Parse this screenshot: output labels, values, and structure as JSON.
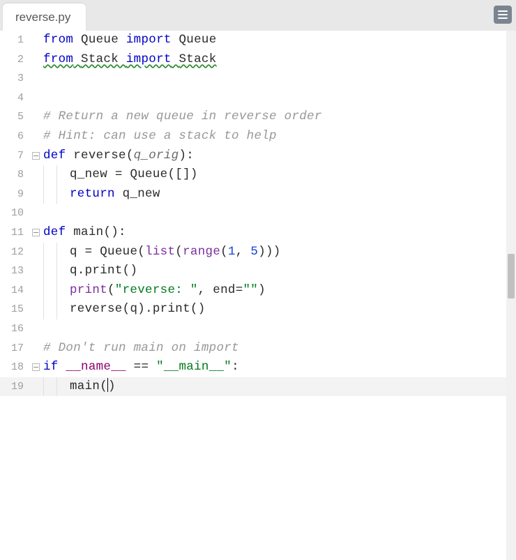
{
  "tab": {
    "title": "reverse.py"
  },
  "icons": {
    "menu": "menu-icon"
  },
  "code": {
    "lines": [
      {
        "n": 1,
        "indent": 0,
        "fold": false,
        "current": false,
        "tokens": [
          [
            "from",
            "kw"
          ],
          [
            " ",
            "p"
          ],
          [
            "Queue",
            "id"
          ],
          [
            " ",
            "p"
          ],
          [
            "import",
            "kw"
          ],
          [
            " ",
            "p"
          ],
          [
            "Queue",
            "id"
          ]
        ]
      },
      {
        "n": 2,
        "indent": 0,
        "fold": false,
        "current": false,
        "tokens": [
          [
            "from",
            "kw warn"
          ],
          [
            " ",
            "p warn"
          ],
          [
            "Stack",
            "id warn"
          ],
          [
            " ",
            "p warn"
          ],
          [
            "import",
            "kw warn"
          ],
          [
            " ",
            "p warn"
          ],
          [
            "Stack",
            "id warn"
          ]
        ]
      },
      {
        "n": 3,
        "indent": 0,
        "fold": false,
        "current": false,
        "tokens": []
      },
      {
        "n": 4,
        "indent": 0,
        "fold": false,
        "current": false,
        "tokens": []
      },
      {
        "n": 5,
        "indent": 0,
        "fold": false,
        "current": false,
        "tokens": [
          [
            "# Return a new queue in reverse order",
            "com"
          ]
        ]
      },
      {
        "n": 6,
        "indent": 0,
        "fold": false,
        "current": false,
        "tokens": [
          [
            "# Hint: can use a stack to help",
            "com"
          ]
        ]
      },
      {
        "n": 7,
        "indent": 0,
        "fold": true,
        "current": false,
        "tokens": [
          [
            "def",
            "def"
          ],
          [
            " ",
            "p"
          ],
          [
            "reverse",
            "fn"
          ],
          [
            "(",
            "p"
          ],
          [
            "q_orig",
            "param"
          ],
          [
            ")",
            "p"
          ],
          [
            ":",
            "p"
          ]
        ]
      },
      {
        "n": 8,
        "indent": 2,
        "fold": false,
        "current": false,
        "tokens": [
          [
            "q_new",
            "id"
          ],
          [
            " ",
            "p"
          ],
          [
            "=",
            "p"
          ],
          [
            " ",
            "p"
          ],
          [
            "Queue",
            "id"
          ],
          [
            "(",
            "p"
          ],
          [
            "[]",
            "p"
          ],
          [
            ")",
            "p"
          ]
        ]
      },
      {
        "n": 9,
        "indent": 2,
        "fold": false,
        "current": false,
        "tokens": [
          [
            "return",
            "kw"
          ],
          [
            " ",
            "p"
          ],
          [
            "q_new",
            "id"
          ]
        ]
      },
      {
        "n": 10,
        "indent": 0,
        "fold": false,
        "current": false,
        "tokens": []
      },
      {
        "n": 11,
        "indent": 0,
        "fold": true,
        "current": false,
        "tokens": [
          [
            "def",
            "def"
          ],
          [
            " ",
            "p"
          ],
          [
            "main",
            "fn"
          ],
          [
            "()",
            "p"
          ],
          [
            ":",
            "p"
          ]
        ]
      },
      {
        "n": 12,
        "indent": 2,
        "fold": false,
        "current": false,
        "tokens": [
          [
            "q",
            "id"
          ],
          [
            " ",
            "p"
          ],
          [
            "=",
            "p"
          ],
          [
            " ",
            "p"
          ],
          [
            "Queue",
            "id"
          ],
          [
            "(",
            "p"
          ],
          [
            "list",
            "builtin"
          ],
          [
            "(",
            "p"
          ],
          [
            "range",
            "builtin"
          ],
          [
            "(",
            "p"
          ],
          [
            "1",
            "num"
          ],
          [
            ",",
            "p"
          ],
          [
            " ",
            "p"
          ],
          [
            "5",
            "num"
          ],
          [
            ")))",
            "p"
          ]
        ]
      },
      {
        "n": 13,
        "indent": 2,
        "fold": false,
        "current": false,
        "tokens": [
          [
            "q",
            "id"
          ],
          [
            ".",
            "p"
          ],
          [
            "print",
            "id"
          ],
          [
            "()",
            "p"
          ]
        ]
      },
      {
        "n": 14,
        "indent": 2,
        "fold": false,
        "current": false,
        "tokens": [
          [
            "print",
            "builtin"
          ],
          [
            "(",
            "p"
          ],
          [
            "\"reverse: \"",
            "str"
          ],
          [
            ",",
            "p"
          ],
          [
            " ",
            "p"
          ],
          [
            "end",
            "id"
          ],
          [
            "=",
            "p"
          ],
          [
            "\"\"",
            "str"
          ],
          [
            ")",
            "p"
          ]
        ]
      },
      {
        "n": 15,
        "indent": 2,
        "fold": false,
        "current": false,
        "tokens": [
          [
            "reverse",
            "id"
          ],
          [
            "(",
            "p"
          ],
          [
            "q",
            "id"
          ],
          [
            ")",
            "p"
          ],
          [
            ".",
            "p"
          ],
          [
            "print",
            "id"
          ],
          [
            "()",
            "p"
          ]
        ]
      },
      {
        "n": 16,
        "indent": 0,
        "fold": false,
        "current": false,
        "tokens": []
      },
      {
        "n": 17,
        "indent": 0,
        "fold": false,
        "current": false,
        "tokens": [
          [
            "# Don't run main on import",
            "com"
          ]
        ]
      },
      {
        "n": 18,
        "indent": 0,
        "fold": true,
        "current": false,
        "tokens": [
          [
            "if",
            "kw"
          ],
          [
            " ",
            "p"
          ],
          [
            "__name__",
            "dunder"
          ],
          [
            " ",
            "p"
          ],
          [
            "==",
            "p"
          ],
          [
            " ",
            "p"
          ],
          [
            "\"__main__\"",
            "str"
          ],
          [
            ":",
            "p"
          ]
        ]
      },
      {
        "n": 19,
        "indent": 2,
        "fold": false,
        "current": true,
        "tokens": [
          [
            "main",
            "id"
          ],
          [
            "(",
            "p"
          ],
          [
            ")",
            "p"
          ]
        ],
        "caretAfter": 2
      }
    ]
  },
  "scrollbar": {
    "thumbTop": 320,
    "thumbHeight": 64
  }
}
